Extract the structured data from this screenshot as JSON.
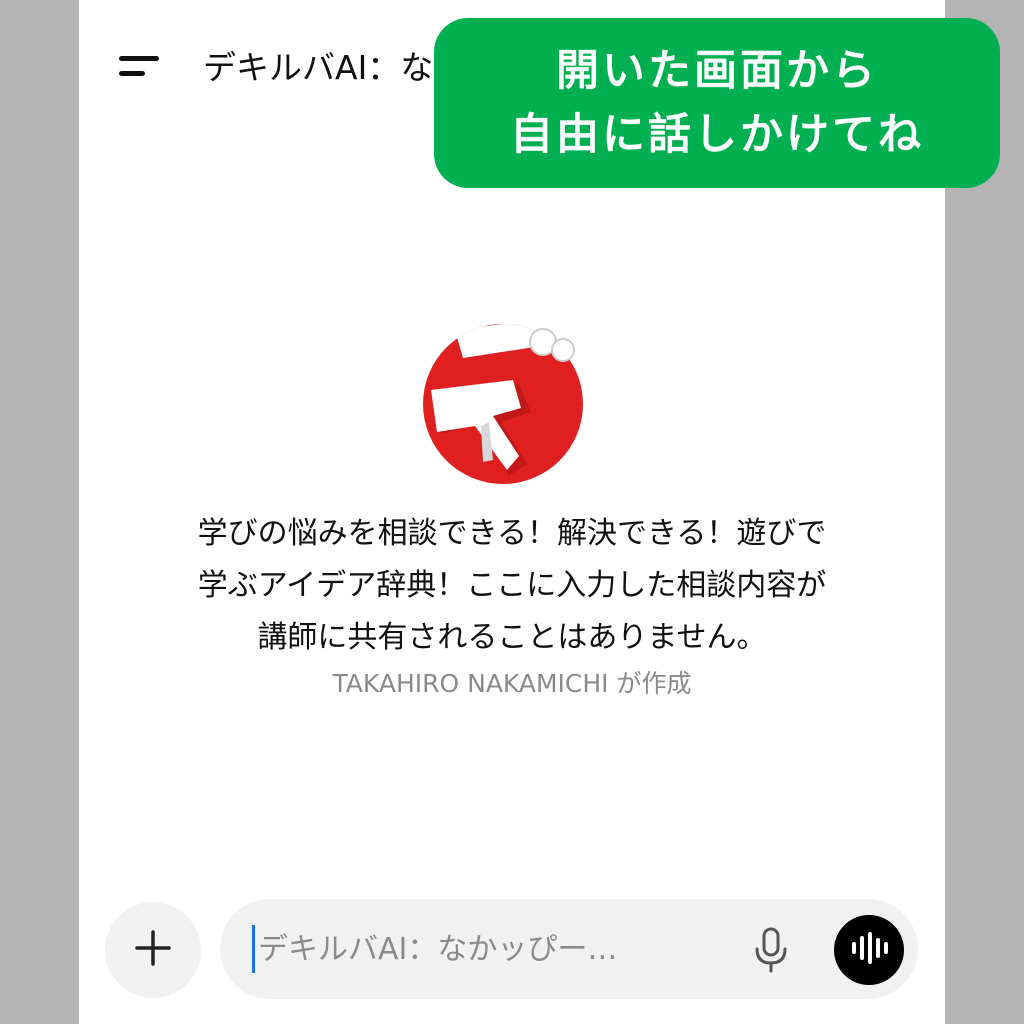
{
  "header": {
    "title": "デキルバAI：な",
    "menu_icon": "hamburger-menu-icon"
  },
  "banner": {
    "line1": "開いた画面から",
    "line2": "自由に話しかけてね",
    "color": "#00b050"
  },
  "gpt": {
    "logo_icon": "dekiruba-logo-icon",
    "logo_color": "#e02020",
    "description_lines": [
      "学びの悩みを相談できる！解決できる！遊びで",
      "学ぶアイデア辞典！ここに入力した相談内容が",
      "講師に共有されることはありません。"
    ],
    "author": "TAKAHIRO NAKAMICHI が作成"
  },
  "composer": {
    "placeholder": "デキルバAI：なかッぴー…",
    "value": "",
    "plus_icon": "plus-icon",
    "mic_icon": "microphone-icon",
    "voice_icon": "voice-mode-icon"
  }
}
